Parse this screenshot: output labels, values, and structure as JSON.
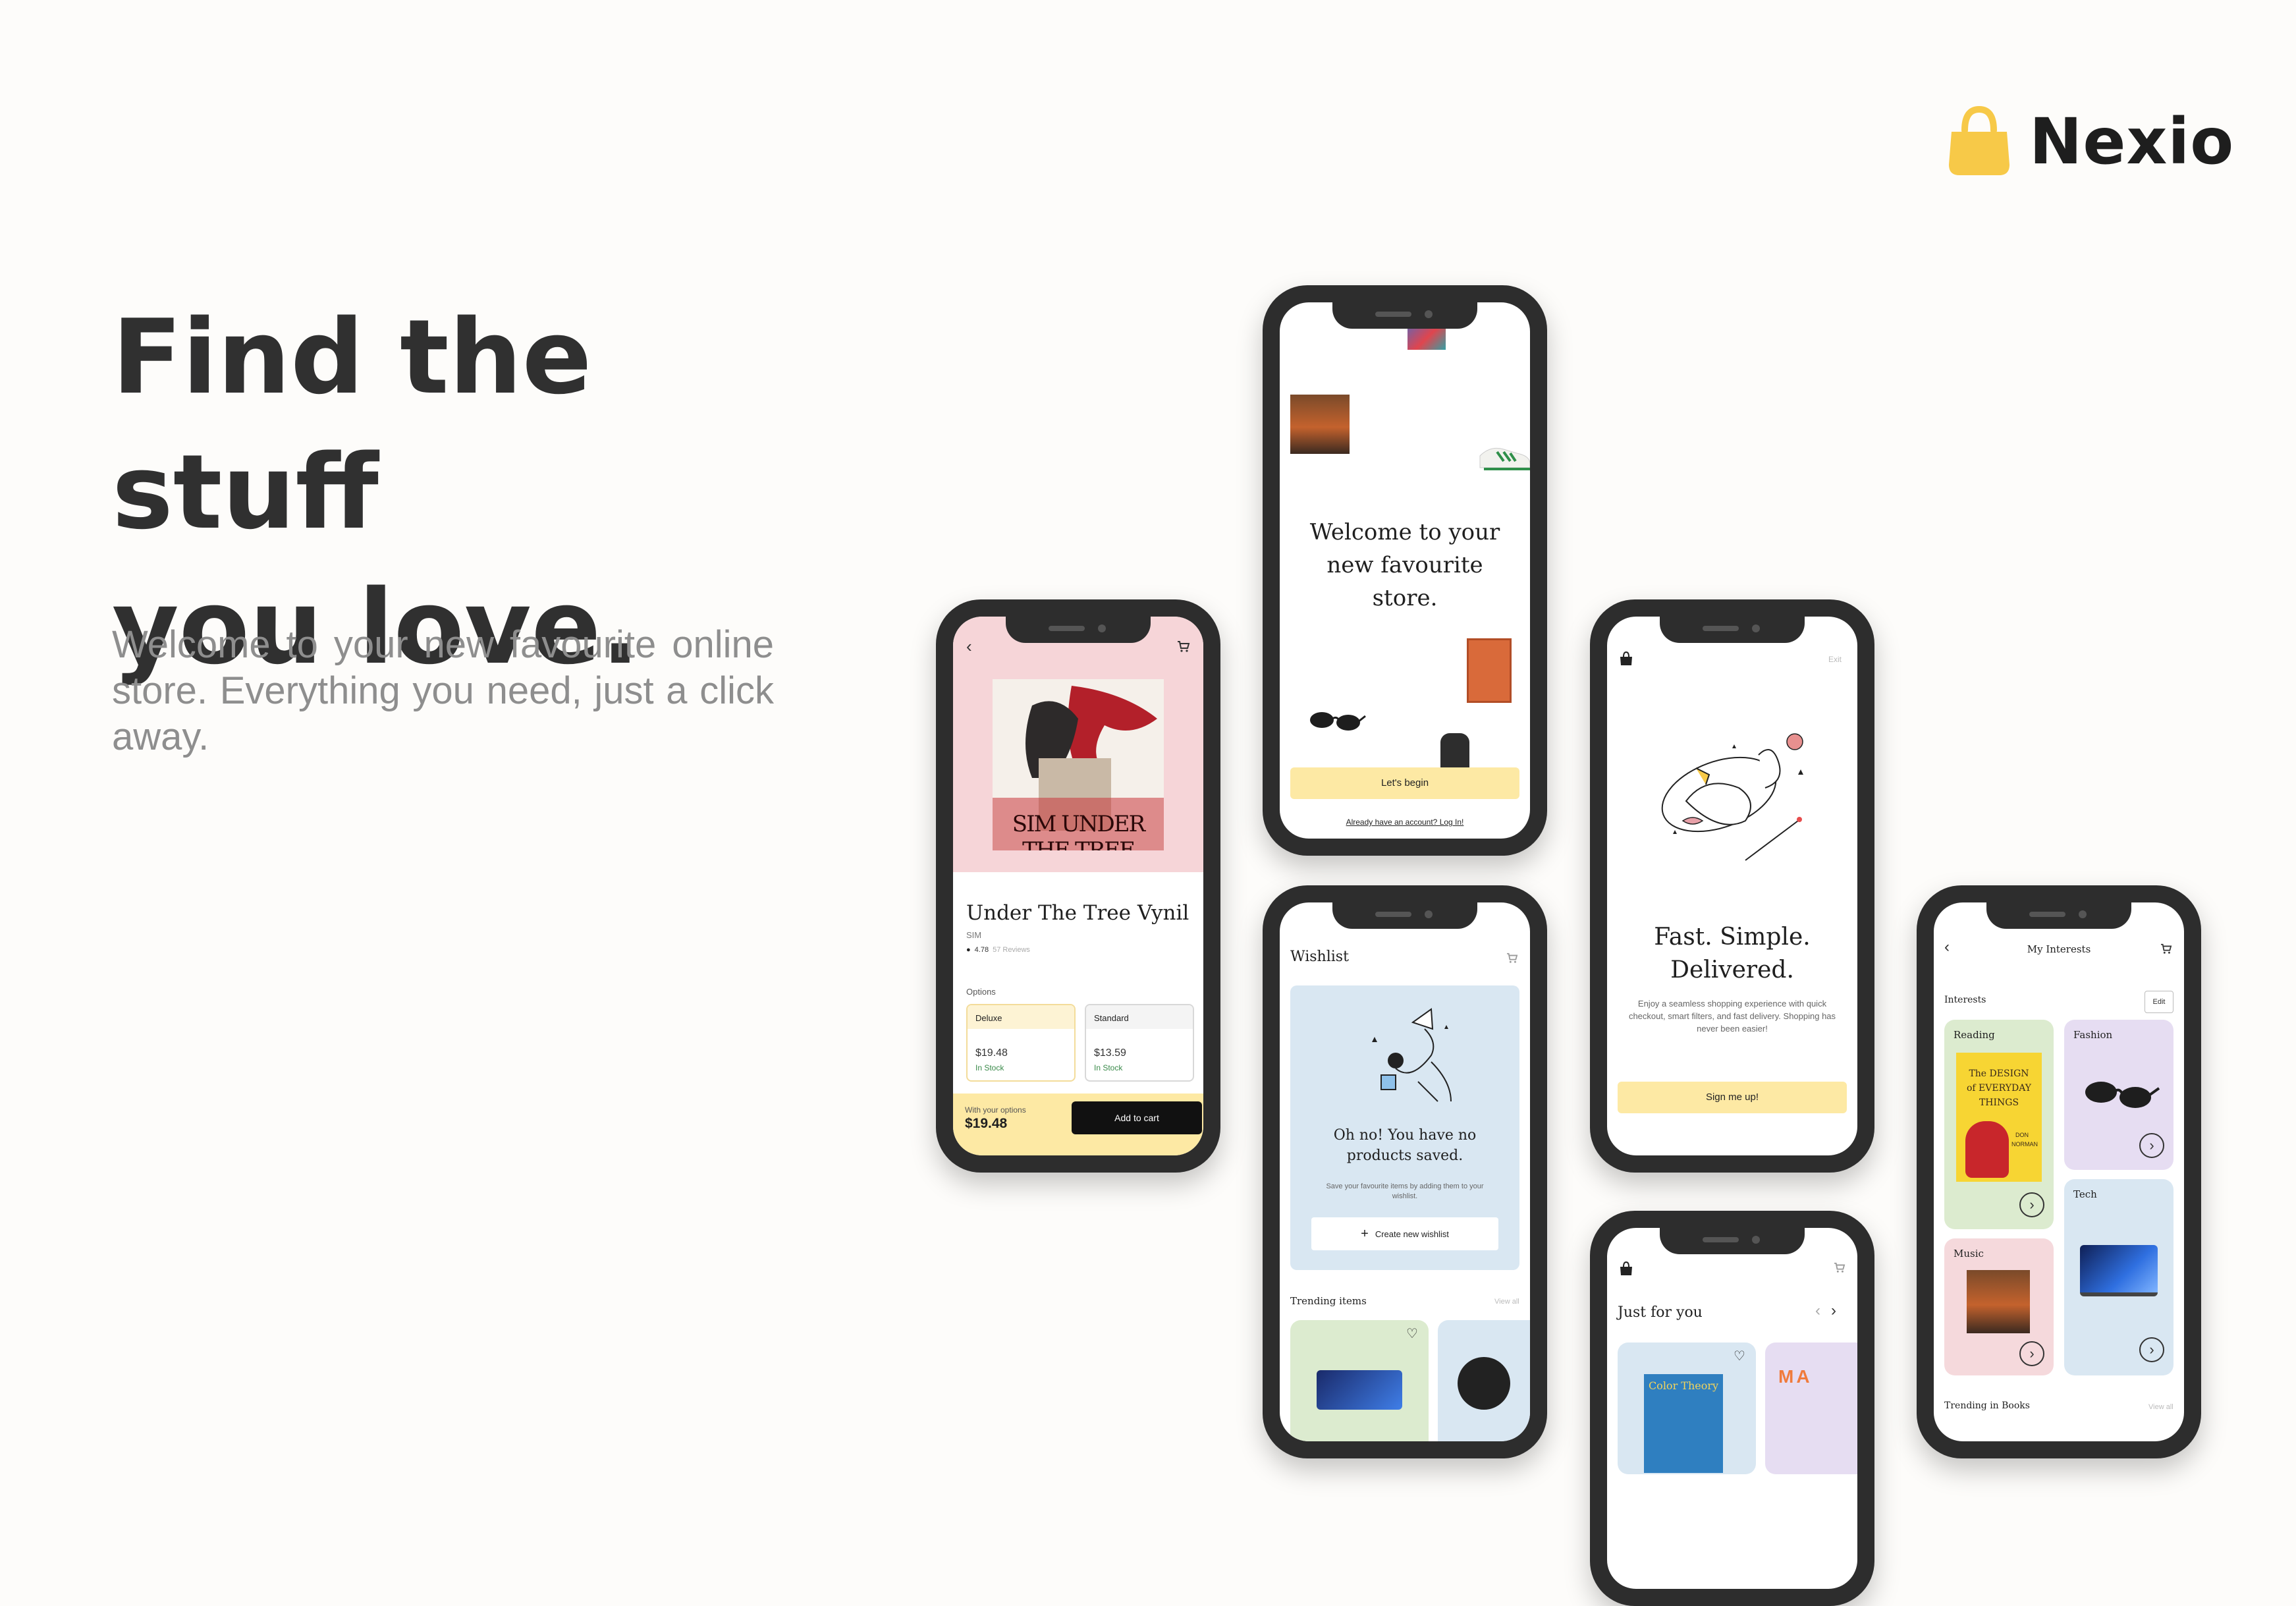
{
  "brand": {
    "name": "Nexio",
    "accent": "#f7c948"
  },
  "hero": {
    "headline_line1": "Find the stuff",
    "headline_line2": "you love.",
    "subtext": "Welcome to your new favourite online store. Everything you need, just a click away."
  },
  "product_screen": {
    "album_label": "SIM UNDER THE TREE",
    "title": "Under The Tree Vynil",
    "artist": "SIM",
    "rating": "4.78",
    "reviews": "57 Reviews",
    "options_label": "Options",
    "options": [
      {
        "name": "Deluxe",
        "price": "$19.48",
        "stock": "In Stock"
      },
      {
        "name": "Standard",
        "price": "$13.59",
        "stock": "In Stock"
      }
    ],
    "with_options_label": "With your options",
    "total": "$19.48",
    "add_to_cart": "Add to cart"
  },
  "welcome_screen": {
    "title": "Welcome to your new favourite store.",
    "cta": "Let's begin",
    "login_link": "Already have an account? Log In!"
  },
  "delivered_screen": {
    "exit": "Exit",
    "title_line1": "Fast. Simple.",
    "title_line2": "Delivered.",
    "body": "Enjoy a seamless shopping experience with quick checkout, smart filters, and fast delivery. Shopping has never been easier!",
    "cta": "Sign me up!"
  },
  "wishlist_screen": {
    "title": "Wishlist",
    "empty_title": "Oh no! You have no products saved.",
    "empty_body": "Save your favourite items by adding them to your wishlist.",
    "create_button": "Create new wishlist",
    "trending_label": "Trending items",
    "view_all": "View all"
  },
  "justforyou_screen": {
    "title": "Just for you",
    "book_title": "Color Theory"
  },
  "interests_screen": {
    "title": "My Interests",
    "section_label": "Interests",
    "edit": "Edit",
    "categories": [
      {
        "name": "Reading",
        "color": "#dcebcf"
      },
      {
        "name": "Fashion",
        "color": "#e6ddf2"
      },
      {
        "name": "Tech",
        "color": "#d9e7f2"
      },
      {
        "name": "Music",
        "color": "#f5d9dc"
      }
    ],
    "book_cover": {
      "line1": "The DESIGN",
      "line2": "of EVERYDAY",
      "line3": "THINGS",
      "author_first": "DON",
      "author_last": "NORMAN"
    },
    "trending_label": "Trending in Books",
    "view_all": "View all"
  }
}
